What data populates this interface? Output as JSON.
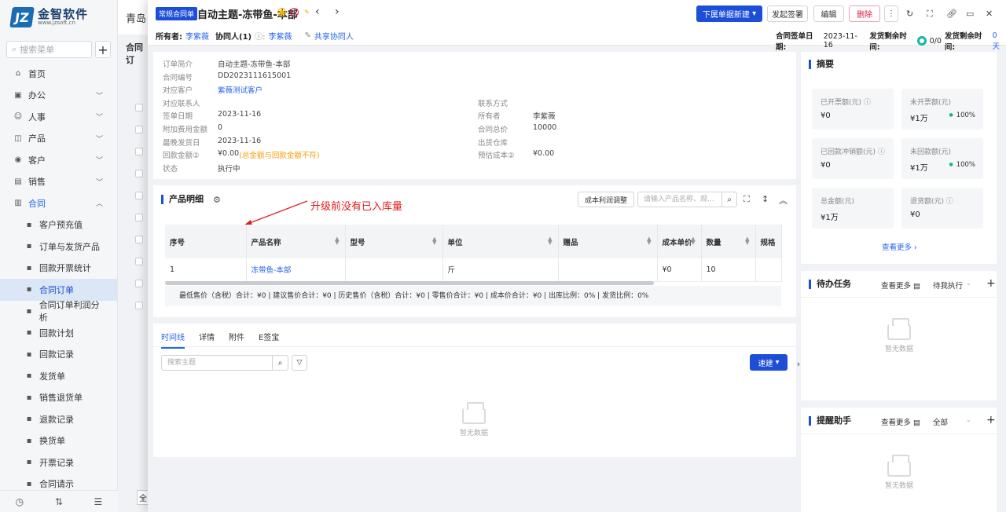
{
  "sidebar": {
    "logo_name": "金智软件",
    "logo_url": "www.jzsoft.cn",
    "search_placeholder": "搜索菜单",
    "items": [
      {
        "label": "首页",
        "icon": "home-icon"
      },
      {
        "label": "办公",
        "icon": "office-icon"
      },
      {
        "label": "人事",
        "icon": "people-icon"
      },
      {
        "label": "产品",
        "icon": "box-icon"
      },
      {
        "label": "客户",
        "icon": "customer-icon"
      },
      {
        "label": "销售",
        "icon": "sales-icon"
      },
      {
        "label": "合同",
        "icon": "contract-icon"
      }
    ],
    "sub_items": [
      "客户预充值",
      "订单与发货产品",
      "回款开票统计",
      "合同订单",
      "合同订单利润分析",
      "回款计划",
      "回款记录",
      "发货单",
      "销售退货单",
      "退款记录",
      "换货单",
      "开票记录",
      "合同请示"
    ]
  },
  "background": {
    "title": "青岛",
    "tab": "合同订",
    "select": "全"
  },
  "drawer": {
    "badge": "常规合同单",
    "title": "自动主题-冻带鱼-本部",
    "owner_label": "所有者:",
    "owner": "李紫薇",
    "collab_label": "协同人(1)",
    "collab": "李紫薇",
    "share": "共享协同人",
    "buttons": {
      "new_sub": "下属单据新建",
      "sign": "发起签署",
      "edit": "编辑",
      "delete": "删除"
    },
    "sign_date_label": "合同签单日期:",
    "sign_date": "2023-11-16",
    "ship_remain_label": "发货剩余时间:",
    "ship_progress": "0/0",
    "ship_remain_label2": "发货剩余时间:",
    "ship_days": "0 天"
  },
  "info": {
    "left": [
      {
        "k": "订单简介",
        "v": "自动主题-冻带鱼-本部"
      },
      {
        "k": "合同编号",
        "v": "DD2023111615001"
      },
      {
        "k": "对应客户",
        "v": "紫薇测试客户"
      },
      {
        "k": "对应联系人",
        "v": ""
      },
      {
        "k": "签单日期",
        "v": "2023-11-16"
      },
      {
        "k": "附加费用金额",
        "v": "0"
      },
      {
        "k": "最晚发货日",
        "v": "2023-11-16"
      },
      {
        "k": "回款金额②",
        "v": "¥0.00",
        "warn": "(总金额与回款金额不符)"
      },
      {
        "k": "状态",
        "v": "执行中"
      }
    ],
    "right": [
      {
        "k": "联系方式",
        "v": ""
      },
      {
        "k": "所有者",
        "v": "李紫薇"
      },
      {
        "k": "合同总价",
        "v": "10000"
      },
      {
        "k": "出货仓库",
        "v": ""
      },
      {
        "k": "预估成本②",
        "v": "¥0.00"
      }
    ]
  },
  "products": {
    "title": "产品明细",
    "cost_button": "成本利润调整",
    "search_placeholder": "请输入产品名称、规...",
    "annotation": "升级前没有已入库量",
    "columns": [
      "序号",
      "产品名称",
      "型号",
      "单位",
      "赠品",
      "成本单价",
      "数量",
      "规格"
    ],
    "rows": [
      [
        "1",
        "冻带鱼-本部",
        "",
        "斤",
        "",
        "¥0",
        "10",
        ""
      ]
    ],
    "totals": "最低售价（含税）合计：¥0 |   建议售价合计：¥0 |   历史售价（含税）合计：¥0 |   零售价合计：¥0 |   成本价合计：¥0 |   出库比例：0% |   发货比例：0%"
  },
  "timeline": {
    "tabs": [
      "时间线",
      "详情",
      "附件",
      "E签宝"
    ],
    "search_placeholder": "搜索主题",
    "new_button": "速建",
    "empty": "暂无数据"
  },
  "summary": {
    "title": "摘要",
    "stats": [
      {
        "label": "已开票额(元)",
        "value": "¥0",
        "pct": ""
      },
      {
        "label": "未开票额(元)",
        "value": "¥1万",
        "pct": "100%"
      },
      {
        "label": "已回款冲销额(元)",
        "value": "¥0",
        "pct": ""
      },
      {
        "label": "未回款额(元)",
        "value": "¥1万",
        "pct": "100%"
      },
      {
        "label": "总金额(元)",
        "value": "¥1万",
        "pct": ""
      },
      {
        "label": "退货额(元)",
        "value": "¥0",
        "pct": ""
      }
    ],
    "more": "查看更多"
  },
  "todo": {
    "title": "待办任务",
    "more": "查看更多",
    "filter": "待我执行",
    "empty": "暂无数据"
  },
  "remind": {
    "title": "提醒助手",
    "more": "查看更多",
    "filter": "全部",
    "empty": "暂无数据"
  }
}
